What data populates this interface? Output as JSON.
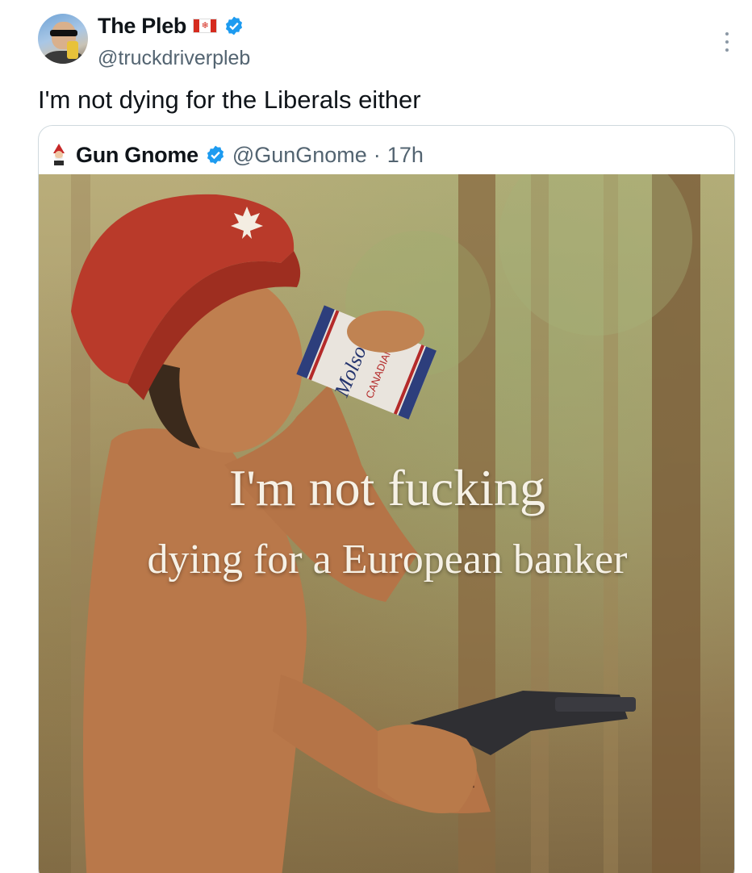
{
  "author": {
    "display_name": "The Pleb",
    "flag_icon": "canada-flag-icon",
    "verified_icon": "verified-badge-icon",
    "handle": "@truckdriverpleb",
    "avatar": "avatar"
  },
  "tweet": {
    "text": "I'm not dying for the Liberals either"
  },
  "quoted": {
    "icon": "gnome-avatar-icon",
    "display_name": "Gun Gnome",
    "verified_icon": "verified-badge-icon",
    "handle": "@GunGnome",
    "separator": "·",
    "time": "17h",
    "image": {
      "can_brand": "Molson",
      "can_text": "CANADIAN",
      "caption_line1": "I'm not fucking",
      "caption_line2": "dying for a European banker"
    }
  },
  "colors": {
    "text": "#0f1419",
    "secondary": "#536471",
    "verified": "#1d9bf0",
    "border": "#cfd9de",
    "beanie": "#b93a2a"
  }
}
